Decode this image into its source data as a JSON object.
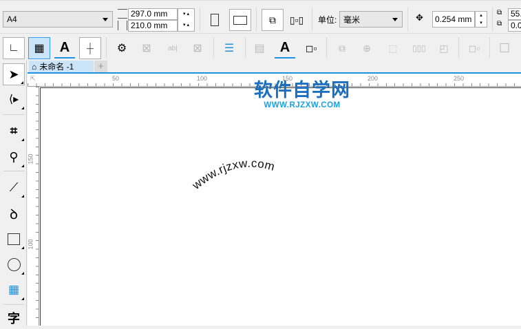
{
  "toolbar": {
    "page_size": "A4",
    "width": "297.0 mm",
    "height": "210.0 mm",
    "unit_label": "单位:",
    "unit_value": "毫米",
    "nudge": "0.254 mm",
    "dup_x": "55.",
    "dup_y": "0.0"
  },
  "tab": {
    "title": "未命名 -1",
    "add": "+"
  },
  "ruler": {
    "h_ticks": [
      "50",
      "100",
      "150",
      "200",
      "250"
    ],
    "v_ticks": [
      "150",
      "100"
    ]
  },
  "canvas": {
    "curved_text": "www.rjzxw.com"
  },
  "watermark": {
    "title": "软件自学网",
    "url": "WWW.RJZXW.COM"
  },
  "colors": {
    "accent": "#1e90e0",
    "watermark_blue": "#1a6fc0",
    "watermark_cyan": "#1aa0e8"
  }
}
